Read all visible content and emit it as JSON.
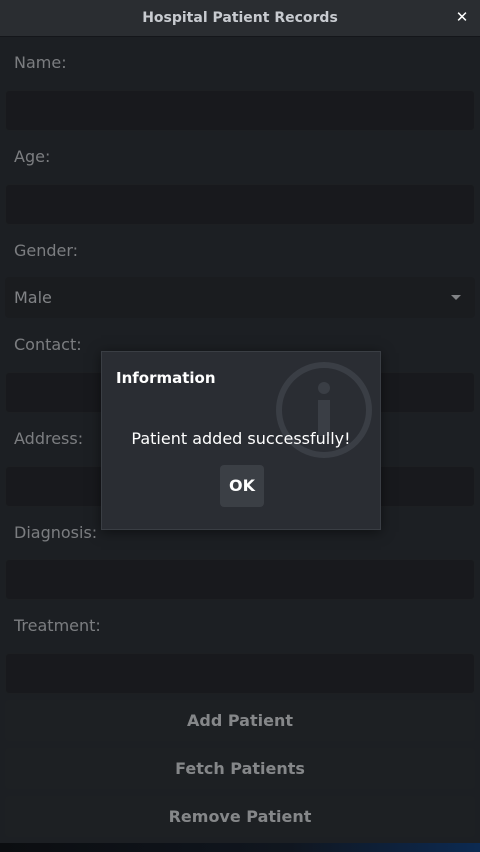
{
  "window": {
    "title": "Hospital Patient Records",
    "close_glyph": "✕"
  },
  "form": {
    "name_label": "Name:",
    "age_label": "Age:",
    "gender_label": "Gender:",
    "gender_value": "Male",
    "contact_label": "Contact:",
    "address_label": "Address:",
    "diagnosis_label": "Diagnosis:",
    "treatment_label": "Treatment:"
  },
  "buttons": {
    "add": "Add Patient",
    "fetch": "Fetch Patients",
    "remove": "Remove Patient"
  },
  "dialog": {
    "title": "Information",
    "message": "Patient added successfully!",
    "ok": "OK",
    "icon": "info-icon"
  }
}
